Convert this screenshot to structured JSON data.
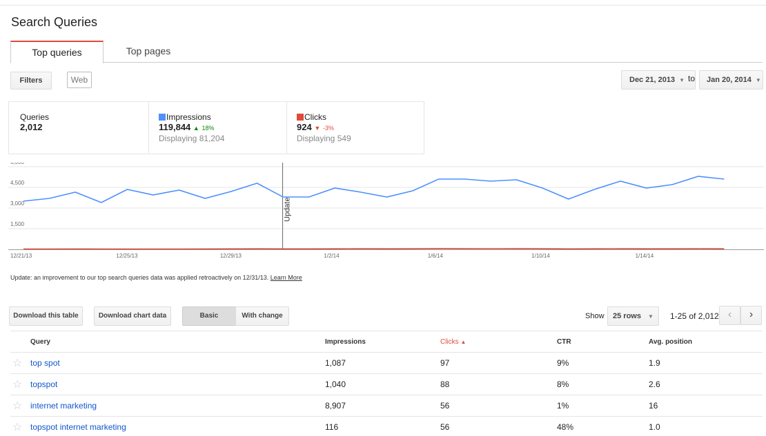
{
  "page": {
    "title": "Search Queries"
  },
  "tabs": [
    {
      "label": "Top queries",
      "active": true
    },
    {
      "label": "Top pages",
      "active": false
    }
  ],
  "filters": {
    "filters_label": "Filters",
    "web_label": "Web"
  },
  "date_range": {
    "start": "Dec 21, 2013",
    "to_label": "to",
    "end": "Jan 20, 2014"
  },
  "stats": {
    "queries": {
      "label": "Queries",
      "value": "2,012"
    },
    "impressions": {
      "label": "Impressions",
      "value": "119,844",
      "change": "18%",
      "displaying": "Displaying 81,204",
      "color": "#4d90fe"
    },
    "clicks": {
      "label": "Clicks",
      "value": "924",
      "change": "-3%",
      "displaying": "Displaying 549",
      "color": "#dd4b39"
    }
  },
  "chart_data": {
    "type": "line",
    "x": [
      "12/21/13",
      "12/22/13",
      "12/23/13",
      "12/24/13",
      "12/25/13",
      "12/26/13",
      "12/27/13",
      "12/28/13",
      "12/29/13",
      "12/30/13",
      "12/31/13",
      "1/1/14",
      "1/2/14",
      "1/3/14",
      "1/4/14",
      "1/5/14",
      "1/6/14",
      "1/7/14",
      "1/8/14",
      "1/9/14",
      "1/10/14",
      "1/11/14",
      "1/12/14",
      "1/13/14",
      "1/14/14",
      "1/15/14",
      "1/16/14",
      "1/17/14",
      "1/18/14"
    ],
    "x_tick_labels": [
      "12/21/13",
      "12/25/13",
      "12/29/13",
      "1/2/14",
      "1/6/14",
      "1/10/14",
      "1/14/14"
    ],
    "y_tick_labels": [
      "6,000",
      "4,500",
      "3,000",
      "1,500"
    ],
    "ylim": [
      0,
      6000
    ],
    "series": [
      {
        "name": "Impressions",
        "color": "#4d90fe",
        "values": [
          3500,
          3700,
          4150,
          3400,
          4350,
          3950,
          4300,
          3700,
          4200,
          4800,
          3800,
          3800,
          4450,
          4150,
          3800,
          4250,
          5100,
          5100,
          4950,
          5050,
          4450,
          3650,
          4350,
          4950,
          4450,
          4700,
          5300,
          5100
        ]
      },
      {
        "name": "Clicks",
        "color": "#dd4b39",
        "values": [
          20,
          25,
          28,
          25,
          22,
          25,
          27,
          30,
          35,
          40,
          35,
          35,
          40,
          45,
          40,
          45,
          60,
          55,
          50,
          55,
          45,
          35,
          40,
          45,
          40,
          40,
          45,
          40
        ]
      }
    ],
    "annotation": {
      "label": "Update",
      "x": "12/31/13"
    }
  },
  "note": {
    "text": "Update: an improvement to our top search queries data was applied retroactively on 12/31/13.",
    "link": "Learn More"
  },
  "table_toolbar": {
    "download_table": "Download this table",
    "download_chart": "Download chart data",
    "basic": "Basic",
    "with_change": "With change",
    "show_label": "Show",
    "rows_select": "25 rows",
    "range": "1-25 of 2,012"
  },
  "table": {
    "headers": {
      "query": "Query",
      "impressions": "Impressions",
      "clicks": "Clicks",
      "ctr": "CTR",
      "avg_position": "Avg. position"
    },
    "rows": [
      {
        "query": "top spot",
        "impressions": "1,087",
        "clicks": "97",
        "ctr": "9%",
        "avg_position": "1.9"
      },
      {
        "query": "topspot",
        "impressions": "1,040",
        "clicks": "88",
        "ctr": "8%",
        "avg_position": "2.6"
      },
      {
        "query": "internet marketing",
        "impressions": "8,907",
        "clicks": "56",
        "ctr": "1%",
        "avg_position": "16"
      },
      {
        "query": "topspot internet marketing",
        "impressions": "116",
        "clicks": "56",
        "ctr": "48%",
        "avg_position": "1.0"
      }
    ]
  }
}
